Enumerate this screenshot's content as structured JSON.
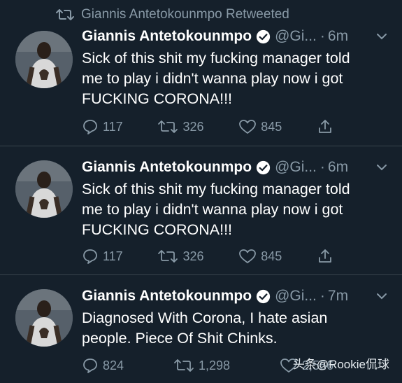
{
  "retweet_label": "Giannis Antetokounmpo Retweeted",
  "tweets": [
    {
      "name": "Giannis Antetokounmpo",
      "handle": "@Gi...",
      "dot": "·",
      "time": "6m",
      "text": "Sick of this shit my fucking manager told\nme to play i didn't wanna play now i got\nFUCKING CORONA!!!",
      "replies": "117",
      "retweets": "326",
      "likes": "845"
    },
    {
      "name": "Giannis Antetokounmpo",
      "handle": "@Gi...",
      "dot": "·",
      "time": "6m",
      "text": "Sick of this shit my fucking manager told\nme to play i didn't wanna play now i got\nFUCKING CORONA!!!",
      "replies": "117",
      "retweets": "326",
      "likes": "845"
    },
    {
      "name": "Giannis Antetokounmpo",
      "handle": "@Gi...",
      "dot": "·",
      "time": "7m",
      "text": "Diagnosed With Corona, I hate asian\npeople. Piece Of Shit Chinks.",
      "replies": "824",
      "retweets": "1,298",
      "likes": "2,556"
    }
  ],
  "watermark": "头条@Rookie侃球",
  "colors": {
    "background": "#15202b",
    "secondary_text": "#8899a6",
    "verified_badge": "#ffffff",
    "divider": "#38444d"
  }
}
